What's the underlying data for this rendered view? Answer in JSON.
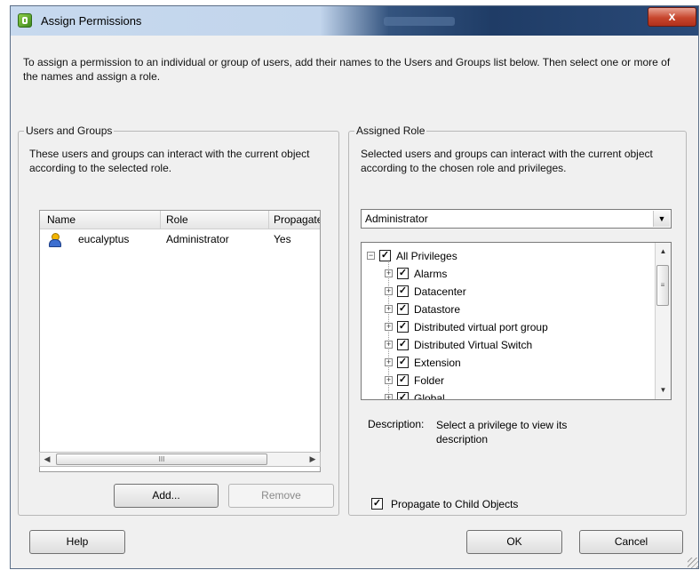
{
  "window": {
    "title": "Assign Permissions",
    "close_label": "x",
    "intro_text": "To assign a permission to an individual or group of users, add their names to the Users and Groups list below. Then select one or more of the names and assign a role."
  },
  "users_groups": {
    "legend": "Users and Groups",
    "description": "These users and groups can interact with the current object according to the selected role.",
    "columns": [
      "Name",
      "Role",
      "Propagate"
    ],
    "rows": [
      {
        "name": "eucalyptus",
        "role": "Administrator",
        "propagate": "Yes"
      }
    ],
    "scroll_marker": "III",
    "add_label": "Add...",
    "remove_label": "Remove"
  },
  "assigned_role": {
    "legend": "Assigned Role",
    "description": "Selected users and groups can interact with the current object according to the chosen role and privileges.",
    "selected_role": "Administrator",
    "privileges_root": "All Privileges",
    "privileges": [
      "Alarms",
      "Datacenter",
      "Datastore",
      "Distributed virtual port group",
      "Distributed Virtual Switch",
      "Extension",
      "Folder",
      "Global"
    ],
    "description_label": "Description:",
    "description_text": "Select a privilege to view its description",
    "propagate_label": "Propagate to Child Objects",
    "propagate_checked": true
  },
  "footer": {
    "help_label": "Help",
    "ok_label": "OK",
    "cancel_label": "Cancel"
  },
  "colors": {
    "close_button": "#c7462d",
    "title_gradient_dark": "#1f3c66",
    "user_icon_head": "#f2b400",
    "user_icon_body": "#3d6fd0"
  }
}
